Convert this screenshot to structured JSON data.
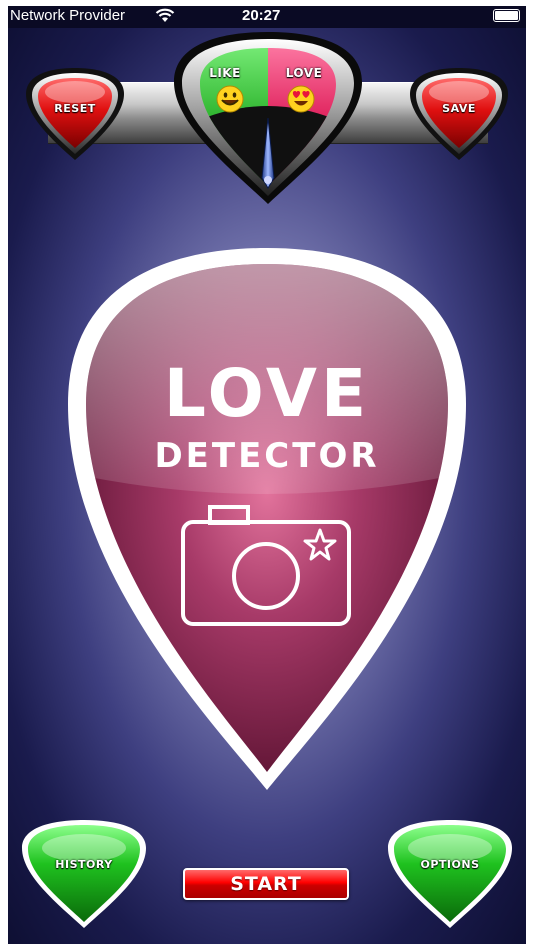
{
  "status_bar": {
    "provider": "Network Provider",
    "time": "20:27"
  },
  "top": {
    "reset_label": "RESET",
    "save_label": "SAVE",
    "meter": {
      "like_label": "LIKE",
      "love_label": "LOVE",
      "like_color": "#2fb52f",
      "love_color": "#e0245e",
      "like_icon": "smiley-face-icon",
      "love_icon": "heart-eyes-face-icon"
    }
  },
  "main": {
    "title_line1": "LOVE",
    "title_line2": "DETECTOR",
    "camera_icon": "camera-star-icon",
    "pick_color": "#8e2e56"
  },
  "bottom": {
    "history_label": "HISTORY",
    "options_label": "OPTIONS",
    "start_label": "START",
    "start_color": "#e00000"
  }
}
